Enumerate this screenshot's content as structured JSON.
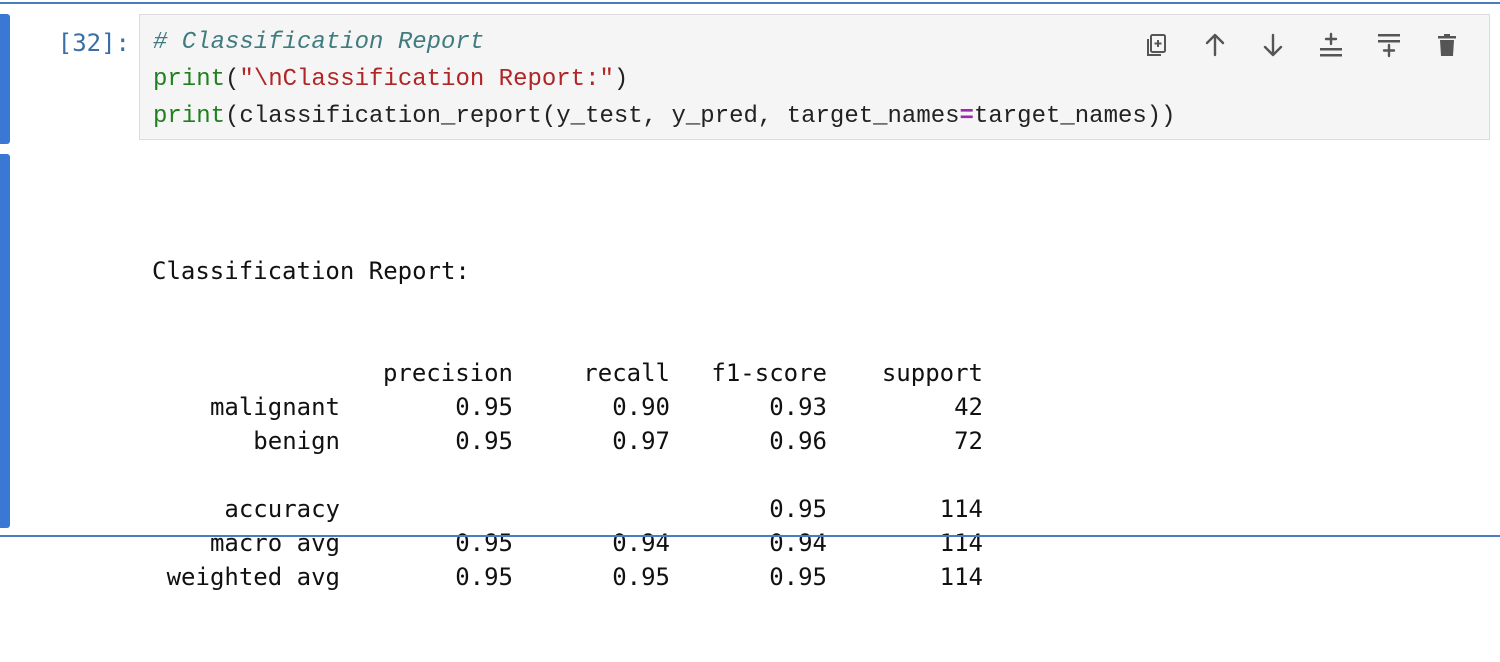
{
  "cell": {
    "prompt": "[32]:",
    "code_lines": [
      {
        "segments": [
          {
            "cls": "c-comment",
            "text": "# Classification Report"
          }
        ]
      },
      {
        "segments": [
          {
            "cls": "c-builtin",
            "text": "print"
          },
          {
            "cls": "c-text",
            "text": "("
          },
          {
            "cls": "c-string",
            "text": "\"\\nClassification Report:\""
          },
          {
            "cls": "c-text",
            "text": ")"
          }
        ]
      },
      {
        "segments": [
          {
            "cls": "c-builtin",
            "text": "print"
          },
          {
            "cls": "c-text",
            "text": "(classification_report(y_test, y_pred, target_names"
          },
          {
            "cls": "c-op",
            "text": "="
          },
          {
            "cls": "c-text",
            "text": "target_names))"
          }
        ]
      }
    ]
  },
  "toolbar": {
    "items": [
      {
        "name": "copy-cell-icon",
        "label": "duplicate"
      },
      {
        "name": "move-up-icon",
        "label": "move up"
      },
      {
        "name": "move-down-icon",
        "label": "move down"
      },
      {
        "name": "insert-above-icon",
        "label": "insert above"
      },
      {
        "name": "insert-below-icon",
        "label": "insert below"
      },
      {
        "name": "delete-icon",
        "label": "delete"
      }
    ],
    "icon_color": "#555555"
  },
  "output": {
    "title": "Classification Report:",
    "headers": [
      "",
      "precision",
      "recall",
      "f1-score",
      "support"
    ],
    "rows": [
      {
        "label": "malignant",
        "precision": "0.95",
        "recall": "0.90",
        "f1": "0.93",
        "support": "42"
      },
      {
        "label": "benign",
        "precision": "0.95",
        "recall": "0.97",
        "f1": "0.96",
        "support": "72"
      },
      {
        "spacer": true
      },
      {
        "label": "accuracy",
        "precision": "",
        "recall": "",
        "f1": "0.95",
        "support": "114"
      },
      {
        "label": "macro avg",
        "precision": "0.95",
        "recall": "0.94",
        "f1": "0.94",
        "support": "114"
      },
      {
        "label": "weighted avg",
        "precision": "0.95",
        "recall": "0.95",
        "f1": "0.95",
        "support": "114"
      }
    ]
  },
  "colors": {
    "accent": "#3b78d4",
    "prompt": "#3b6ea5",
    "editor_bg": "#f5f5f5"
  }
}
